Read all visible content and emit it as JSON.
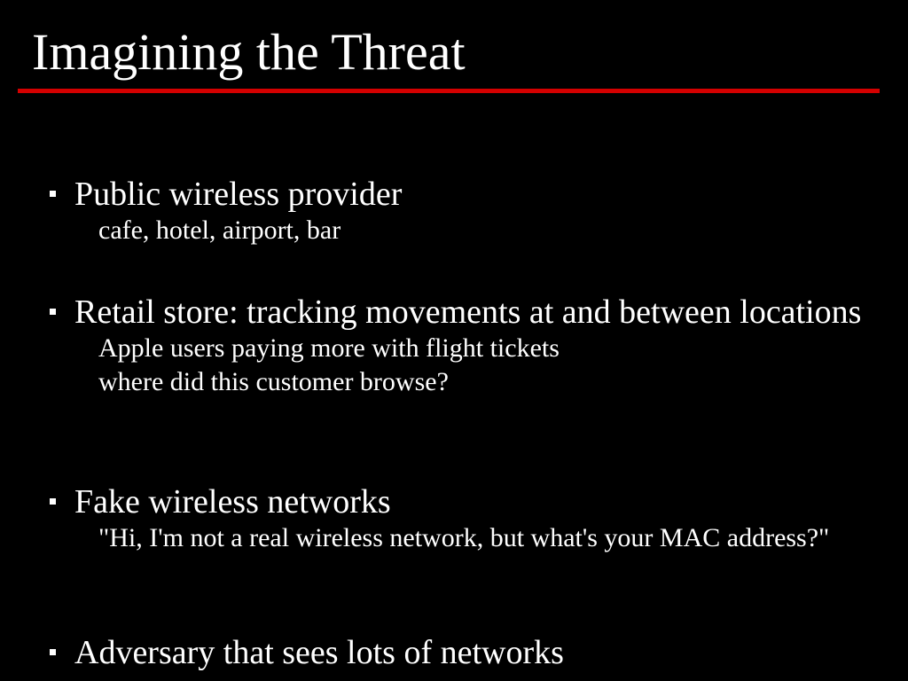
{
  "slide": {
    "title": "Imagining the Threat",
    "accent_color": "#d40000",
    "bullets": [
      {
        "text": "Public wireless provider",
        "sub": [
          "cafe, hotel, airport, bar"
        ]
      },
      {
        "text": "Retail store: tracking movements at and between locations",
        "sub": [
          "Apple users paying more with flight tickets",
          "where did this customer browse?"
        ]
      },
      {
        "text": "Fake wireless networks",
        "sub": [
          "\"Hi, I'm not a real wireless network, but what's your MAC address?\""
        ]
      },
      {
        "text": "Adversary that sees lots of networks",
        "sub": []
      }
    ]
  }
}
